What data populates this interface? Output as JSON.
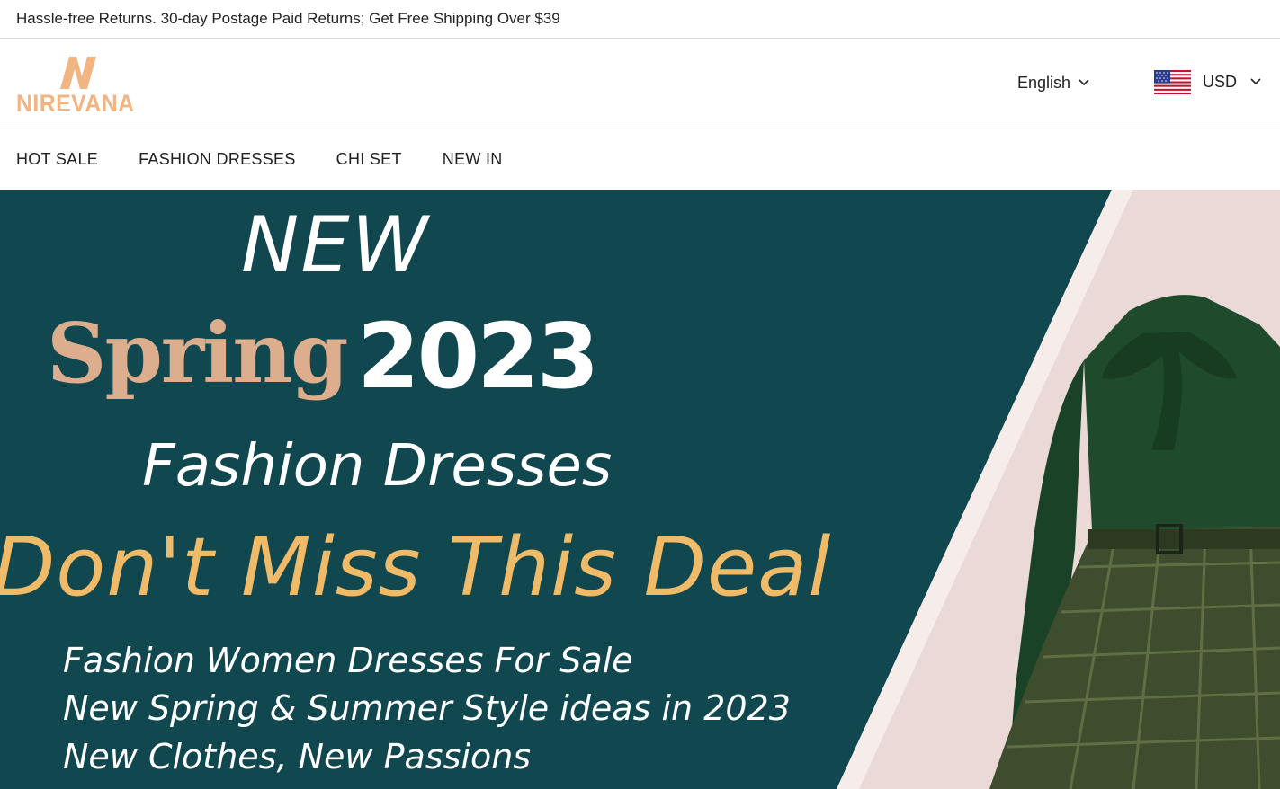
{
  "announcement": {
    "text": "Hassle-free Returns. 30-day Postage Paid Returns; Get Free Shipping Over $39"
  },
  "header": {
    "logo": {
      "letter": "N",
      "wordmark": "NIREVANA",
      "color": "#f1b483"
    },
    "language": {
      "label": "English",
      "icon": "chevron-down-icon"
    },
    "currency": {
      "label": "USD",
      "flag_icon": "us-flag-icon",
      "icon": "chevron-down-icon"
    }
  },
  "nav": {
    "items": [
      {
        "label": "HOT SALE"
      },
      {
        "label": "FASHION DRESSES"
      },
      {
        "label": "CHI SET"
      },
      {
        "label": "NEW IN"
      }
    ]
  },
  "hero": {
    "colors": {
      "panel": "#11474f",
      "background": "#ead9d6",
      "accent_gold": "#f0bb68",
      "accent_peach": "#dcae8d",
      "dress_green": "#1f4b2c"
    },
    "headline_new": "NEW",
    "headline_spring": "Spring",
    "headline_year": "2023",
    "subheadline": "Fashion Dresses",
    "cta": "Don't Miss This Deal",
    "lines": [
      "Fashion Women Dresses For Sale",
      "New Spring & Summer Style ideas in 2023",
      "New Clothes, New Passions"
    ]
  }
}
